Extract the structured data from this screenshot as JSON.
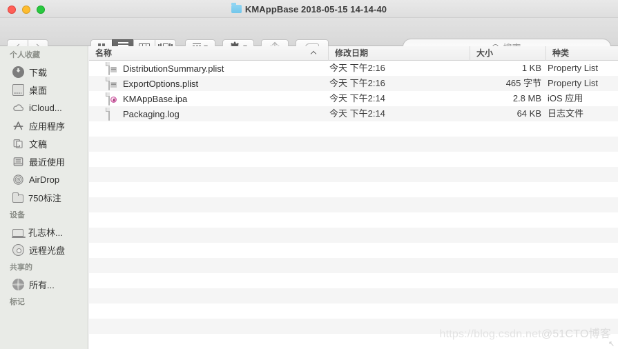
{
  "window": {
    "title": "KMAppBase 2018-05-15 14-14-40",
    "folder_icon": "folder-icon",
    "traffic_lights": {
      "close": "#ff5f57",
      "minimize": "#febc2e",
      "maximize": "#28c840"
    }
  },
  "toolbar": {
    "back_icon": "chevron-left-icon",
    "forward_icon": "chevron-right-icon",
    "view_modes": [
      {
        "name": "icon-view",
        "icon": "grid-icon",
        "active": false
      },
      {
        "name": "list-view",
        "icon": "list-icon",
        "active": true
      },
      {
        "name": "column-view",
        "icon": "columns-icon",
        "active": false
      },
      {
        "name": "coverflow-view",
        "icon": "coverflow-icon",
        "active": false
      }
    ],
    "arrange_icon": "arrange-icon",
    "gear_icon": "gear-icon",
    "share_icon": "share-icon",
    "tag_icon": "tag-icon",
    "dropdown_icon": "chevron-down-icon"
  },
  "search": {
    "placeholder": "搜索",
    "value": "",
    "icon": "search-icon"
  },
  "sidebar": {
    "sections": [
      {
        "header": "个人收藏",
        "items": [
          {
            "label": "下载",
            "icon": "download-icon"
          },
          {
            "label": "桌面",
            "icon": "desktop-icon"
          },
          {
            "label": "iCloud...",
            "icon": "cloud-icon"
          },
          {
            "label": "应用程序",
            "icon": "applications-icon"
          },
          {
            "label": "文稿",
            "icon": "documents-icon"
          },
          {
            "label": "最近使用",
            "icon": "recents-icon"
          },
          {
            "label": "AirDrop",
            "icon": "airdrop-icon"
          },
          {
            "label": "750标注",
            "icon": "folder-icon"
          }
        ]
      },
      {
        "header": "设备",
        "items": [
          {
            "label": "孔志林...",
            "icon": "laptop-icon"
          },
          {
            "label": "远程光盘",
            "icon": "disc-icon"
          }
        ]
      },
      {
        "header": "共享的",
        "items": [
          {
            "label": "所有...",
            "icon": "globe-icon"
          }
        ]
      },
      {
        "header": "标记",
        "items": []
      }
    ]
  },
  "filelist": {
    "columns": [
      {
        "label": "名称",
        "name": "column-name",
        "sorted": true,
        "sort_dir": "asc"
      },
      {
        "label": "修改日期",
        "name": "column-date",
        "sorted": false,
        "sort_dir": ""
      },
      {
        "label": "大小",
        "name": "column-size",
        "sorted": false,
        "sort_dir": ""
      },
      {
        "label": "种类",
        "name": "column-kind",
        "sorted": false,
        "sort_dir": ""
      }
    ],
    "rows": [
      {
        "name": "DistributionSummary.plist",
        "date": "今天 下午2:16",
        "size": "1 KB",
        "kind": "Property List",
        "icon": "plist-file-icon"
      },
      {
        "name": "ExportOptions.plist",
        "date": "今天 下午2:16",
        "size": "465 字节",
        "kind": "Property List",
        "icon": "plist-file-icon"
      },
      {
        "name": "KMAppBase.ipa",
        "date": "今天 下午2:14",
        "size": "2.8 MB",
        "kind": "iOS 应用",
        "icon": "ipa-file-icon"
      },
      {
        "name": "Packaging.log",
        "date": "今天 下午2:14",
        "size": "64 KB",
        "kind": "日志文件",
        "icon": "log-file-icon"
      }
    ],
    "empty_row_count": 14
  },
  "watermark": {
    "text_primary": "https://blog.csdn.net",
    "text_secondary": "@51CTO博客"
  }
}
